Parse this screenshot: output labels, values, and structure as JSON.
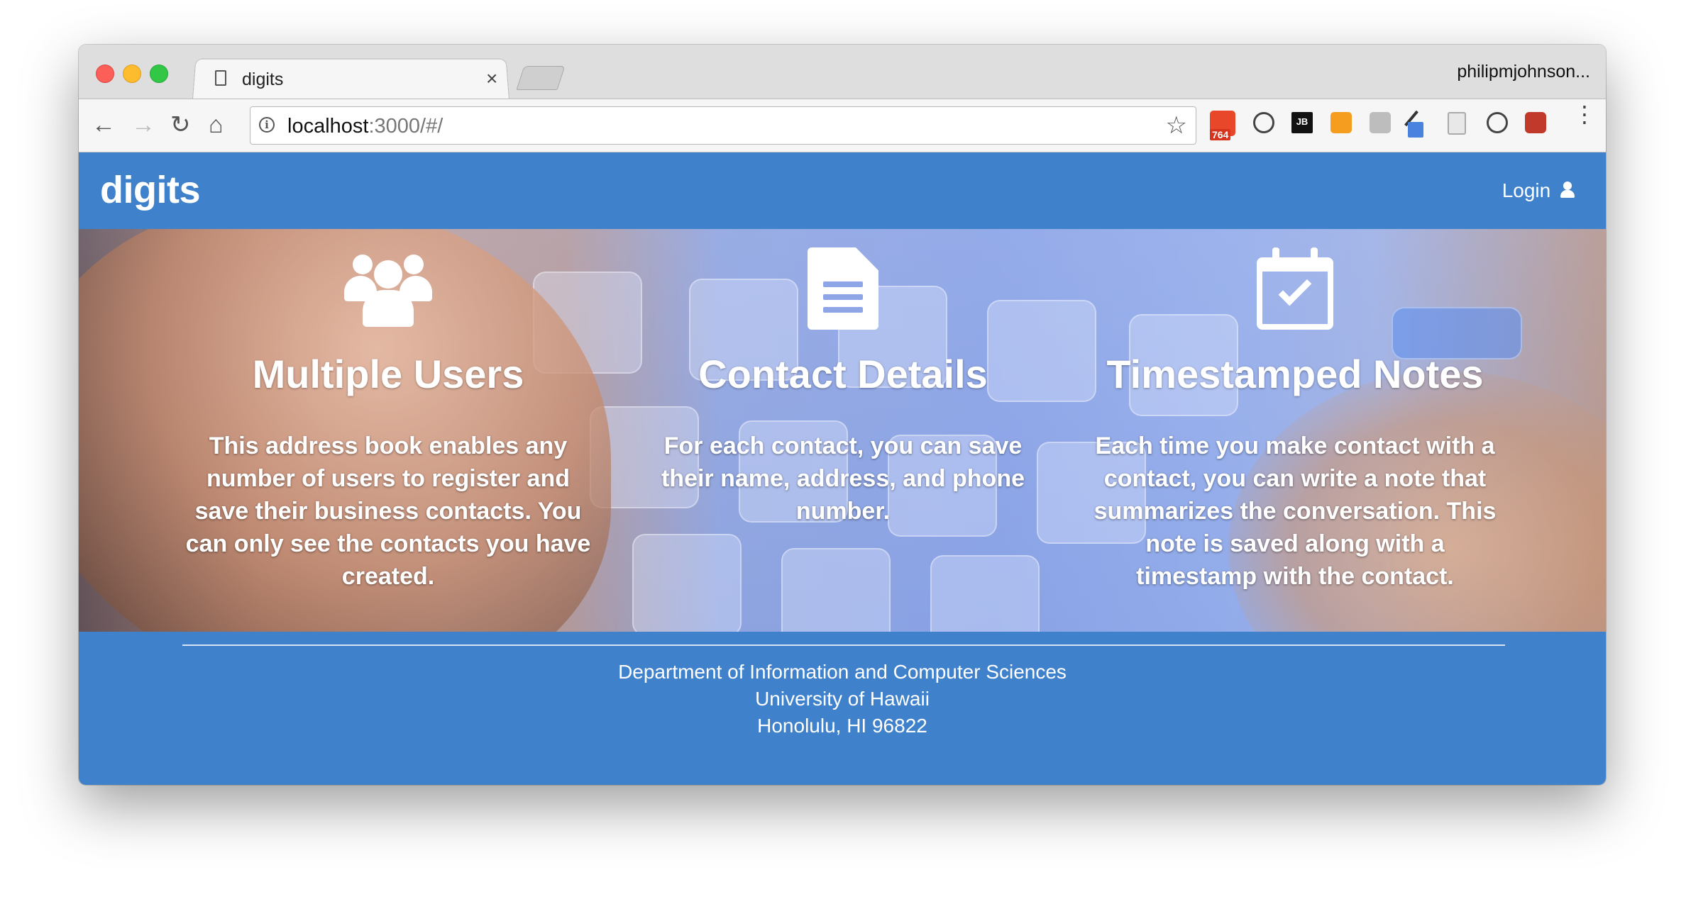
{
  "browser": {
    "tab_title": "digits",
    "tab_close": "×",
    "profile_name": "philipmjohnson...",
    "url_host": "localhost",
    "url_rest": ":3000/#/",
    "extension_badge": "764",
    "extension_jb": "JB"
  },
  "navbar": {
    "brand": "digits",
    "login_label": "Login"
  },
  "features": [
    {
      "icon": "users-icon",
      "title": "Multiple Users",
      "text": "This address book enables any number of users to register and save their business contacts. You can only see the contacts you have created."
    },
    {
      "icon": "file-text-icon",
      "title": "Contact Details",
      "text": "For each contact, you can save their name, address, and phone number."
    },
    {
      "icon": "calendar-check-icon",
      "title": "Timestamped Notes",
      "text": "Each time you make contact with a contact, you can write a note that summarizes the conversation. This note is saved along with a timestamp with the contact."
    }
  ],
  "footer": {
    "line1": "Department of Information and Computer Sciences",
    "line2": "University of Hawaii",
    "line3": "Honolulu, HI 96822"
  },
  "colors": {
    "brand_blue": "#3f82cb",
    "white": "#ffffff"
  }
}
